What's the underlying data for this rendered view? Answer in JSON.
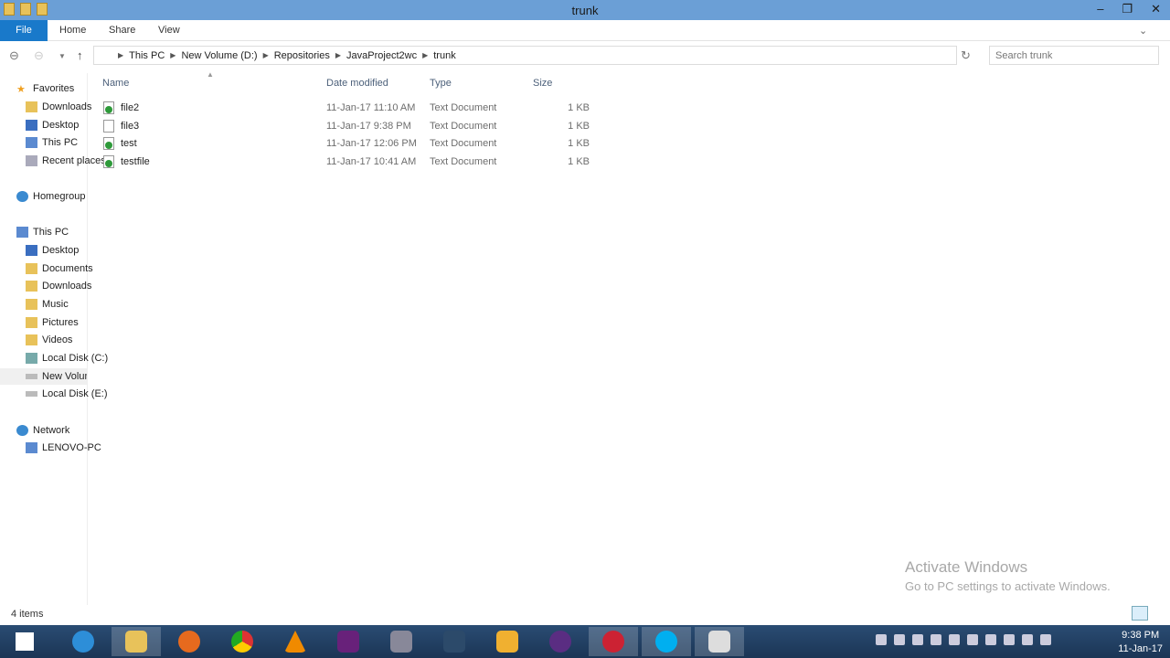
{
  "window": {
    "title": "trunk"
  },
  "ribbon": {
    "file": "File",
    "tabs": [
      "Home",
      "Share",
      "View"
    ]
  },
  "address": {
    "crumbs": [
      "This PC",
      "New Volume (D:)",
      "Repositories",
      "JavaProject2wc",
      "trunk"
    ],
    "search_placeholder": "Search trunk"
  },
  "nav": {
    "favorites": {
      "label": "Favorites",
      "items": [
        "Downloads",
        "Desktop",
        "This PC",
        "Recent places"
      ]
    },
    "homegroup": "Homegroup",
    "thispc": {
      "label": "This PC",
      "items": [
        "Desktop",
        "Documents",
        "Downloads",
        "Music",
        "Pictures",
        "Videos",
        "Local Disk (C:)",
        "New Volume (D:)",
        "Local Disk (E:)"
      ]
    },
    "network": {
      "label": "Network",
      "items": [
        "LENOVO-PC"
      ]
    }
  },
  "columns": [
    "Name",
    "Date modified",
    "Type",
    "Size"
  ],
  "files": [
    {
      "name": "file2",
      "date": "11-Jan-17 11:10 AM",
      "type": "Text Document",
      "size": "1 KB",
      "status": "ok"
    },
    {
      "name": "file3",
      "date": "11-Jan-17 9:38 PM",
      "type": "Text Document",
      "size": "1 KB",
      "status": "unversioned"
    },
    {
      "name": "test",
      "date": "11-Jan-17 12:06 PM",
      "type": "Text Document",
      "size": "1 KB",
      "status": "ok"
    },
    {
      "name": "testfile",
      "date": "11-Jan-17 10:41 AM",
      "type": "Text Document",
      "size": "1 KB",
      "status": "ok"
    }
  ],
  "status": {
    "count": "4 items"
  },
  "watermark": {
    "title": "Activate Windows",
    "sub": "Go to PC settings to activate Windows."
  },
  "taskbar": {
    "time": "9:38 PM",
    "date": "11-Jan-17"
  }
}
